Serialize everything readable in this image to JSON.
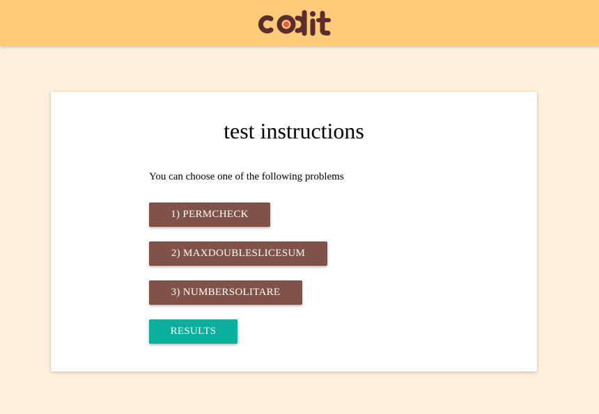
{
  "header": {
    "logo_text": "codit",
    "background_color": "#ffcb7a",
    "logo_color": "#5b2d2d",
    "logo_accent_color": "#e55a47"
  },
  "main": {
    "title": "test instructions",
    "intro": "You can choose one of the following problems",
    "problems": [
      {
        "label": "1) PERMCHECK"
      },
      {
        "label": "2) MAXDOUBLESLICESUM"
      },
      {
        "label": "3) NUMBERSOLITARE"
      }
    ],
    "results_label": "RESULTS"
  },
  "colors": {
    "page_background": "#fef0da",
    "problem_button": "#815348",
    "results_button": "#09ae9c"
  }
}
